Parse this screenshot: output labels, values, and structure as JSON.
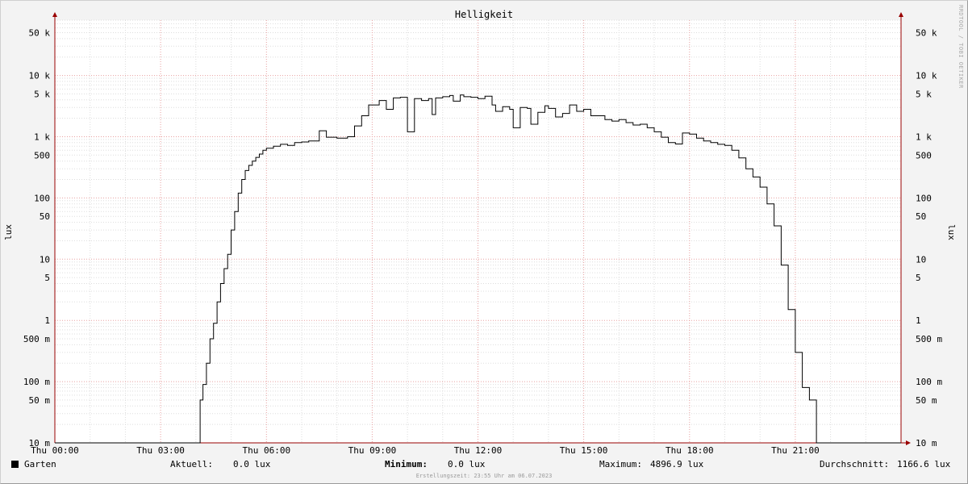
{
  "watermark": "RRDTOOL / TOBI OETIKER",
  "legend": {
    "series_name": "Garten",
    "current_label": "Aktuell:",
    "current_value": "0.0 lux",
    "min_label": "Minimum:",
    "min_value": "0.0 lux",
    "max_label": "Maximum:",
    "max_value": "4896.9 lux",
    "avg_label": "Durchschnitt:",
    "avg_value": "1166.6 lux"
  },
  "footer": "Erstellungszeit: 23:55 Uhr am 06.07.2023",
  "colors": {
    "line": "#000000",
    "major_grid": "#e8a0a0",
    "minor_grid": "#dddddd",
    "axis": "#990000",
    "plot_bg": "#ffffff"
  },
  "chart_data": {
    "type": "line",
    "title": "Helligkeit",
    "ylabel": "lux",
    "yscale": "log",
    "ylim": [
      0.01,
      80000
    ],
    "xlim": [
      0,
      24
    ],
    "grid": true,
    "x_tick_labels": [
      "Thu 00:00",
      "Thu 03:00",
      "Thu 06:00",
      "Thu 09:00",
      "Thu 12:00",
      "Thu 15:00",
      "Thu 18:00",
      "Thu 21:00"
    ],
    "x_tick_hours": [
      0,
      3,
      6,
      9,
      12,
      15,
      18,
      21
    ],
    "y_tick_values": [
      0.01,
      0.05,
      0.1,
      0.5,
      1,
      5,
      10,
      50,
      100,
      500,
      1000,
      5000,
      10000,
      50000
    ],
    "y_tick_labels": [
      "10 m",
      "50 m",
      "100 m",
      "500 m",
      "1",
      "5",
      "10",
      "50",
      "100",
      "500",
      "1 k",
      "5 k",
      "10 k",
      "50 k"
    ],
    "series": [
      {
        "name": "Garten",
        "x_hours": [
          0,
          4.1,
          4.12,
          4.2,
          4.3,
          4.4,
          4.5,
          4.6,
          4.7,
          4.8,
          4.9,
          5.0,
          5.1,
          5.2,
          5.3,
          5.4,
          5.5,
          5.6,
          5.7,
          5.8,
          5.9,
          6.0,
          6.2,
          6.4,
          6.6,
          6.8,
          7.0,
          7.2,
          7.5,
          7.7,
          8.0,
          8.3,
          8.5,
          8.7,
          8.9,
          9.2,
          9.4,
          9.6,
          9.8,
          10.0,
          10.2,
          10.4,
          10.6,
          10.7,
          10.8,
          11.0,
          11.2,
          11.3,
          11.5,
          11.6,
          11.8,
          12.0,
          12.2,
          12.4,
          12.5,
          12.7,
          12.9,
          13.0,
          13.2,
          13.4,
          13.5,
          13.7,
          13.9,
          14.0,
          14.2,
          14.4,
          14.6,
          14.8,
          15.0,
          15.2,
          15.4,
          15.6,
          15.8,
          16.0,
          16.2,
          16.4,
          16.6,
          16.8,
          17.0,
          17.2,
          17.4,
          17.6,
          17.8,
          18.0,
          18.2,
          18.4,
          18.6,
          18.8,
          19.0,
          19.2,
          19.4,
          19.6,
          19.8,
          20.0,
          20.2,
          20.4,
          20.6,
          20.8,
          21.0,
          21.2,
          21.4,
          21.6,
          21.8,
          22.0,
          22.2,
          22.4,
          22.6,
          22.8,
          22.9,
          23.0,
          23.2,
          23.4,
          24.0
        ],
        "y_lux": [
          0.01,
          0.01,
          0.05,
          0.09,
          0.2,
          0.5,
          0.9,
          2,
          4,
          7,
          12,
          30,
          60,
          120,
          200,
          280,
          340,
          400,
          460,
          520,
          600,
          650,
          700,
          750,
          720,
          800,
          820,
          850,
          1250,
          980,
          950,
          1000,
          1500,
          2200,
          3300,
          3900,
          2800,
          4300,
          4400,
          1200,
          4200,
          3900,
          4200,
          2300,
          4300,
          4500,
          4700,
          3800,
          4800,
          4500,
          4400,
          4200,
          4600,
          3300,
          2600,
          3100,
          2800,
          1400,
          3000,
          2900,
          1600,
          2500,
          3200,
          2900,
          2100,
          2400,
          3300,
          2600,
          2800,
          2200,
          2200,
          1900,
          1800,
          1900,
          1700,
          1550,
          1600,
          1400,
          1200,
          980,
          800,
          760,
          1150,
          1100,
          950,
          850,
          800,
          750,
          720,
          600,
          450,
          300,
          220,
          150,
          80,
          35,
          8,
          1.5,
          0.3,
          0.08,
          0.05,
          0.01,
          0.01,
          0.01,
          0.01,
          0.01,
          0.01,
          0.01,
          0.01,
          0.01,
          0.01,
          0.01,
          0.01
        ]
      }
    ]
  }
}
